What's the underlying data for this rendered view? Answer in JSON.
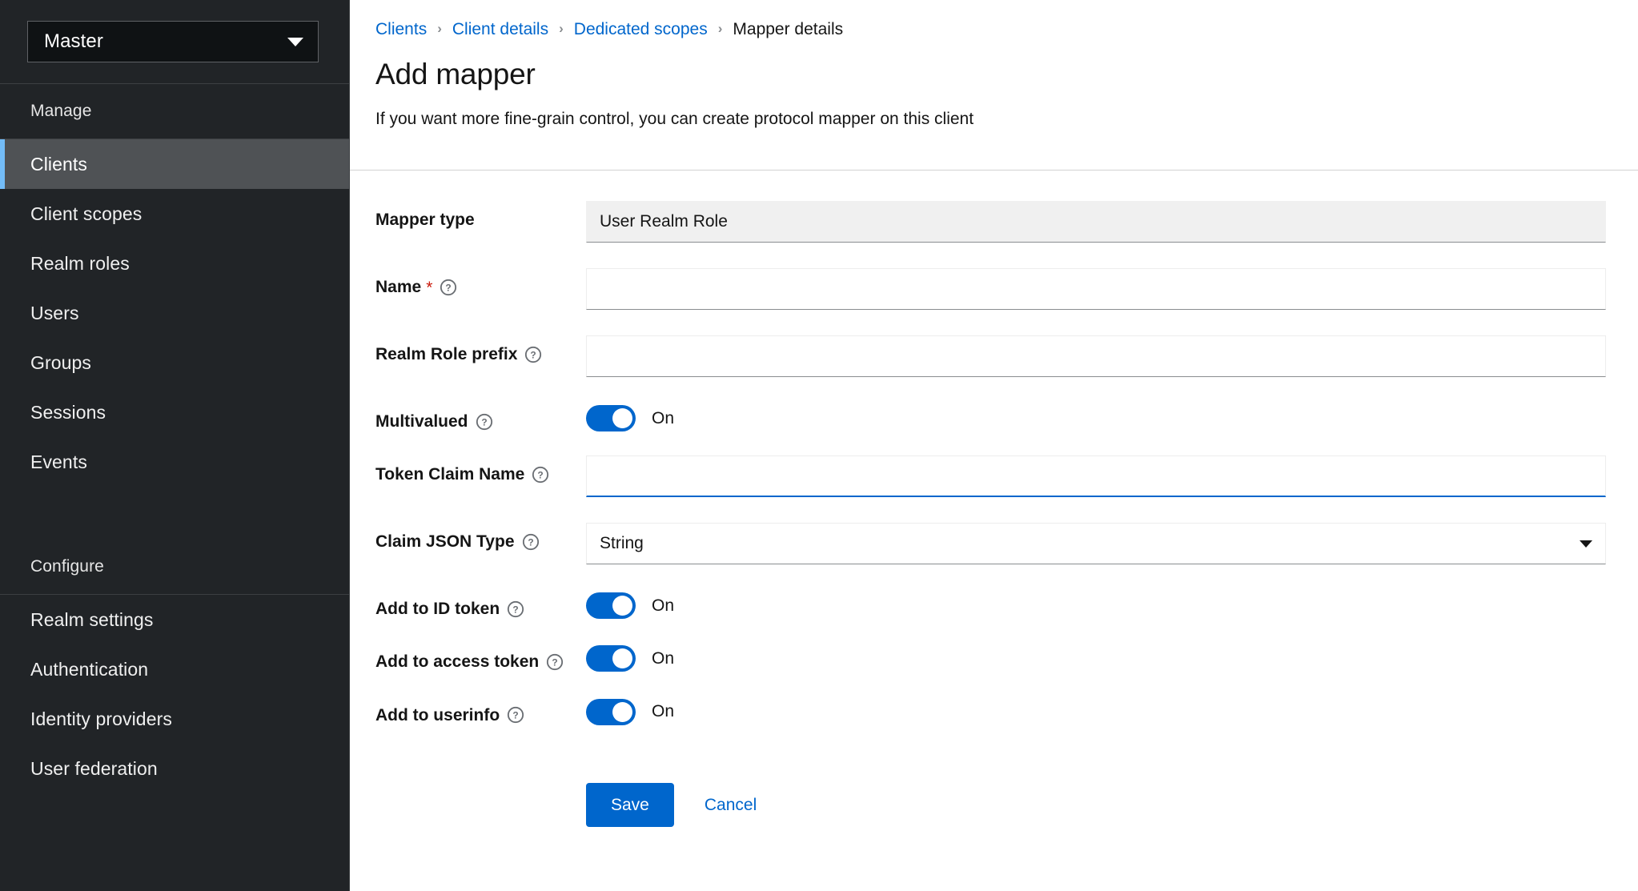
{
  "sidebar": {
    "realm_selector": {
      "value": "Master",
      "caret_icon": "chevron-down-icon"
    },
    "sections": [
      {
        "title": "Manage",
        "items": [
          {
            "label": "Clients",
            "active": true
          },
          {
            "label": "Client scopes",
            "active": false
          },
          {
            "label": "Realm roles",
            "active": false
          },
          {
            "label": "Users",
            "active": false
          },
          {
            "label": "Groups",
            "active": false
          },
          {
            "label": "Sessions",
            "active": false
          },
          {
            "label": "Events",
            "active": false
          }
        ]
      },
      {
        "title": "Configure",
        "items": [
          {
            "label": "Realm settings",
            "active": false
          },
          {
            "label": "Authentication",
            "active": false
          },
          {
            "label": "Identity providers",
            "active": false
          },
          {
            "label": "User federation",
            "active": false
          }
        ]
      }
    ],
    "colors": {
      "background": "#212427",
      "active_background": "#4f5255",
      "active_accent": "#73bcf7"
    }
  },
  "header": {
    "breadcrumb": [
      {
        "label": "Clients",
        "link": true
      },
      {
        "label": "Client details",
        "link": true
      },
      {
        "label": "Dedicated scopes",
        "link": true
      },
      {
        "label": "Mapper details",
        "link": false
      }
    ],
    "breadcrumb_separator": "›",
    "title": "Add mapper",
    "subtitle": "If you want more fine-grain control, you can create protocol mapper on this client"
  },
  "form": {
    "help_icon": "help-circle-icon",
    "required_marker": "*",
    "fields": {
      "mapper_type": {
        "label": "Mapper type",
        "value": "User Realm Role",
        "readonly": true
      },
      "name": {
        "label": "Name",
        "value": "",
        "placeholder": "",
        "required": true
      },
      "realm_role_prefix": {
        "label": "Realm Role prefix",
        "value": "",
        "placeholder": ""
      },
      "multivalued": {
        "label": "Multivalued",
        "state_label": "On",
        "on": true
      },
      "token_claim_name": {
        "label": "Token Claim Name",
        "value": "",
        "placeholder": "",
        "focused": true
      },
      "claim_json_type": {
        "label": "Claim JSON Type",
        "value": "String",
        "caret_icon": "chevron-down-icon"
      },
      "add_to_id_token": {
        "label": "Add to ID token",
        "state_label": "On",
        "on": true
      },
      "add_to_access_token": {
        "label": "Add to access token",
        "state_label": "On",
        "on": true
      },
      "add_to_userinfo": {
        "label": "Add to userinfo",
        "state_label": "On",
        "on": true
      }
    },
    "actions": {
      "save_label": "Save",
      "cancel_label": "Cancel"
    }
  },
  "colors": {
    "primary": "#0066cc",
    "link": "#0066cc",
    "required": "#c9190b",
    "text": "#151515",
    "readonly_bg": "#f0f0f0"
  }
}
